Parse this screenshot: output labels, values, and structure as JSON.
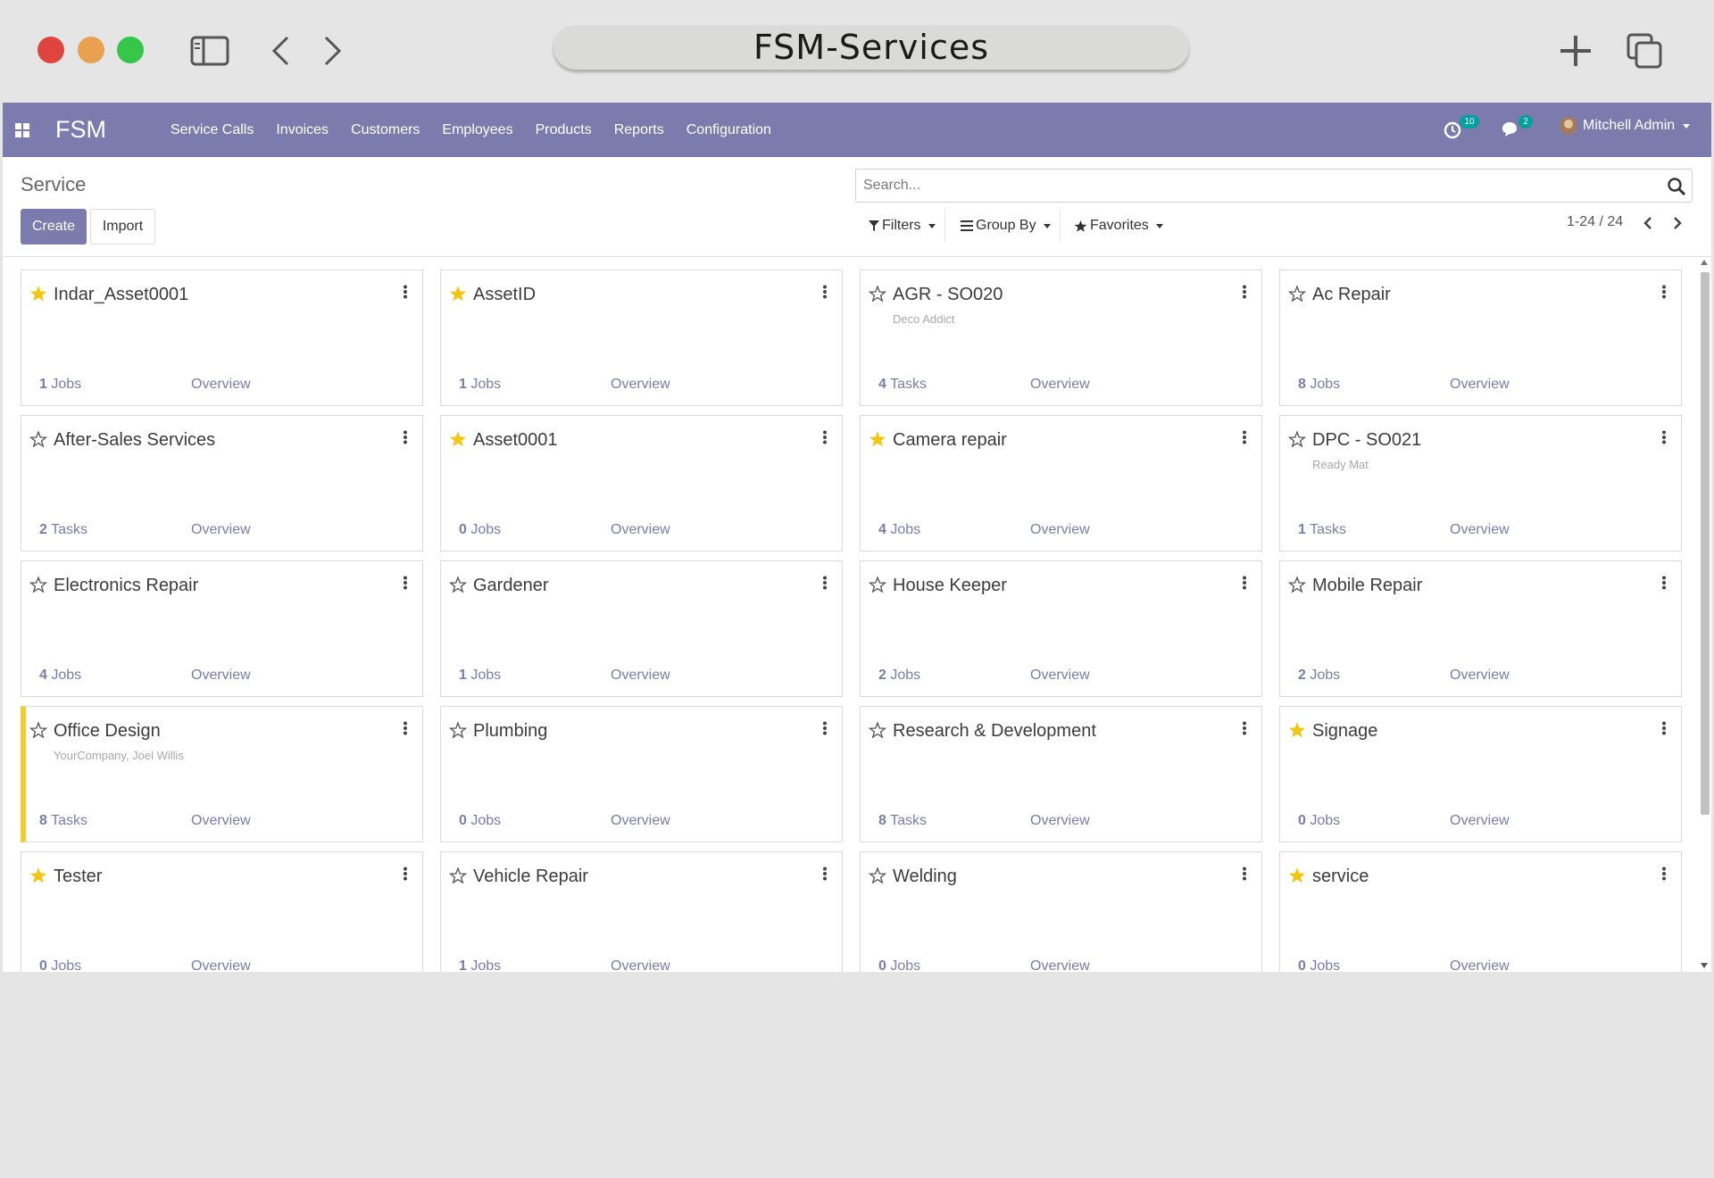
{
  "browser": {
    "title": "FSM-Services",
    "icons": [
      "sidebar-icon",
      "back-icon",
      "forward-icon",
      "new-tab-icon",
      "tabs-overview-icon"
    ]
  },
  "navbar": {
    "brand": "FSM",
    "menu": [
      "Service Calls",
      "Invoices",
      "Customers",
      "Employees",
      "Products",
      "Reports",
      "Configuration"
    ],
    "activity_count": "10",
    "message_count": "2",
    "user": "Mitchell Admin"
  },
  "control": {
    "breadcrumb": "Service",
    "create_label": "Create",
    "import_label": "Import",
    "search_placeholder": "Search...",
    "filters_label": "Filters",
    "groupby_label": "Group By",
    "favorites_label": "Favorites",
    "pager": "1-24 / 24"
  },
  "colors": {
    "brand": "#7c7bad",
    "star_active": "#f3c614",
    "accent_bar": "#f3cc2f",
    "badge": "#00a09d"
  },
  "cards": [
    {
      "title": "Indar_Asset0001",
      "subtitle": "",
      "starred": true,
      "count": "1",
      "unit": "Jobs",
      "link": "Overview",
      "accent": false
    },
    {
      "title": "AssetID",
      "subtitle": "",
      "starred": true,
      "count": "1",
      "unit": "Jobs",
      "link": "Overview",
      "accent": false
    },
    {
      "title": "AGR - SO020",
      "subtitle": "Deco Addict",
      "starred": false,
      "count": "4",
      "unit": "Tasks",
      "link": "Overview",
      "accent": false
    },
    {
      "title": "Ac Repair",
      "subtitle": "",
      "starred": false,
      "count": "8",
      "unit": "Jobs",
      "link": "Overview",
      "accent": false
    },
    {
      "title": "After-Sales Services",
      "subtitle": "",
      "starred": false,
      "count": "2",
      "unit": "Tasks",
      "link": "Overview",
      "accent": false
    },
    {
      "title": "Asset0001",
      "subtitle": "",
      "starred": true,
      "count": "0",
      "unit": "Jobs",
      "link": "Overview",
      "accent": false
    },
    {
      "title": "Camera repair",
      "subtitle": "",
      "starred": true,
      "count": "4",
      "unit": "Jobs",
      "link": "Overview",
      "accent": false
    },
    {
      "title": "DPC - SO021",
      "subtitle": "Ready Mat",
      "starred": false,
      "count": "1",
      "unit": "Tasks",
      "link": "Overview",
      "accent": false
    },
    {
      "title": "Electronics Repair",
      "subtitle": "",
      "starred": false,
      "count": "4",
      "unit": "Jobs",
      "link": "Overview",
      "accent": false
    },
    {
      "title": "Gardener",
      "subtitle": "",
      "starred": false,
      "count": "1",
      "unit": "Jobs",
      "link": "Overview",
      "accent": false
    },
    {
      "title": "House Keeper",
      "subtitle": "",
      "starred": false,
      "count": "2",
      "unit": "Jobs",
      "link": "Overview",
      "accent": false
    },
    {
      "title": "Mobile Repair",
      "subtitle": "",
      "starred": false,
      "count": "2",
      "unit": "Jobs",
      "link": "Overview",
      "accent": false
    },
    {
      "title": "Office Design",
      "subtitle": "YourCompany, Joel Willis",
      "starred": false,
      "count": "8",
      "unit": "Tasks",
      "link": "Overview",
      "accent": true
    },
    {
      "title": "Plumbing",
      "subtitle": "",
      "starred": false,
      "count": "0",
      "unit": "Jobs",
      "link": "Overview",
      "accent": false
    },
    {
      "title": "Research & Development",
      "subtitle": "",
      "starred": false,
      "count": "8",
      "unit": "Tasks",
      "link": "Overview",
      "accent": false
    },
    {
      "title": "Signage",
      "subtitle": "",
      "starred": true,
      "count": "0",
      "unit": "Jobs",
      "link": "Overview",
      "accent": false
    },
    {
      "title": "Tester",
      "subtitle": "",
      "starred": true,
      "count": "0",
      "unit": "Jobs",
      "link": "Overview",
      "accent": false
    },
    {
      "title": "Vehicle Repair",
      "subtitle": "",
      "starred": false,
      "count": "1",
      "unit": "Jobs",
      "link": "Overview",
      "accent": false
    },
    {
      "title": "Welding",
      "subtitle": "",
      "starred": false,
      "count": "0",
      "unit": "Jobs",
      "link": "Overview",
      "accent": false
    },
    {
      "title": "service",
      "subtitle": "",
      "starred": true,
      "count": "0",
      "unit": "Jobs",
      "link": "Overview",
      "accent": false
    }
  ]
}
